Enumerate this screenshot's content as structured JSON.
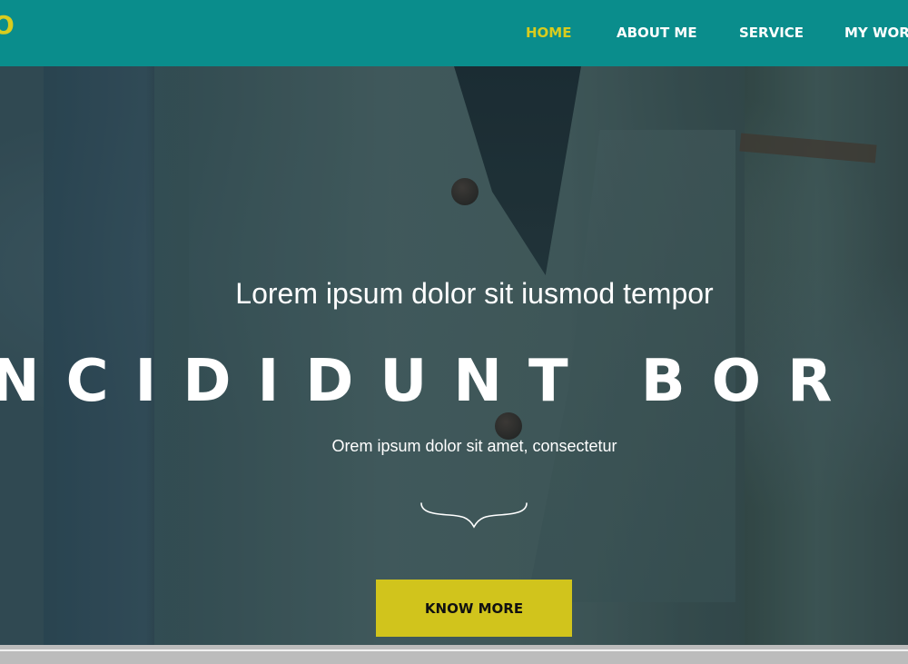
{
  "header": {
    "logo": "O",
    "nav": {
      "home": "HOME",
      "about": "ABOUT ME",
      "service": "SERVICE",
      "work": "MY WORK"
    }
  },
  "hero": {
    "title": "Lorem ipsum dolor sit iusmod tempor",
    "headline": "NCIDIDUNT BOR",
    "subtitle": "Orem ipsum dolor sit amet, consectetur",
    "button_label": "KNOW MORE",
    "icon": "curly-brace-icon"
  },
  "colors": {
    "header_bg": "#0a8d8c",
    "accent_yellow": "#d1c41c",
    "white": "#ffffff",
    "bottom_bar": "#bcbcbc"
  }
}
